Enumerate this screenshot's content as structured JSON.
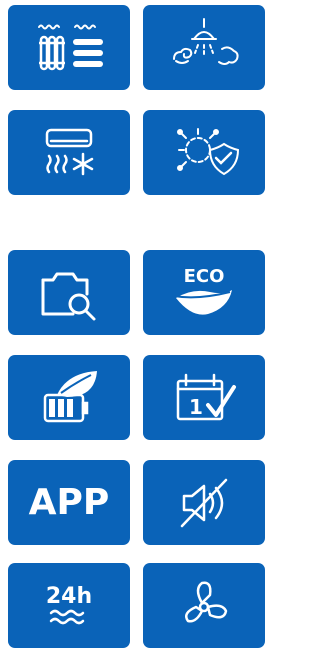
{
  "palette": {
    "tile_bg": "#0a63b8",
    "icon": "#ffffff",
    "page_bg": "#ffffff"
  },
  "tiles": [
    {
      "icon": "radiator-towel-dryer-icon"
    },
    {
      "icon": "shower-steam-icon"
    },
    {
      "icon": "air-conditioner-heat-cool-icon"
    },
    {
      "icon": "antivirus-shield-icon"
    },
    {
      "icon": "camera-inspect-icon"
    },
    {
      "icon": "eco-leaf-icon",
      "text": "ECO"
    },
    {
      "icon": "eco-battery-leaf-icon"
    },
    {
      "icon": "calendar-check-icon",
      "text": "1"
    },
    {
      "icon": "app-label-icon",
      "text": "APP"
    },
    {
      "icon": "mute-speaker-icon"
    },
    {
      "icon": "24h-water-icon",
      "text": "24h"
    },
    {
      "icon": "fan-icon"
    }
  ]
}
